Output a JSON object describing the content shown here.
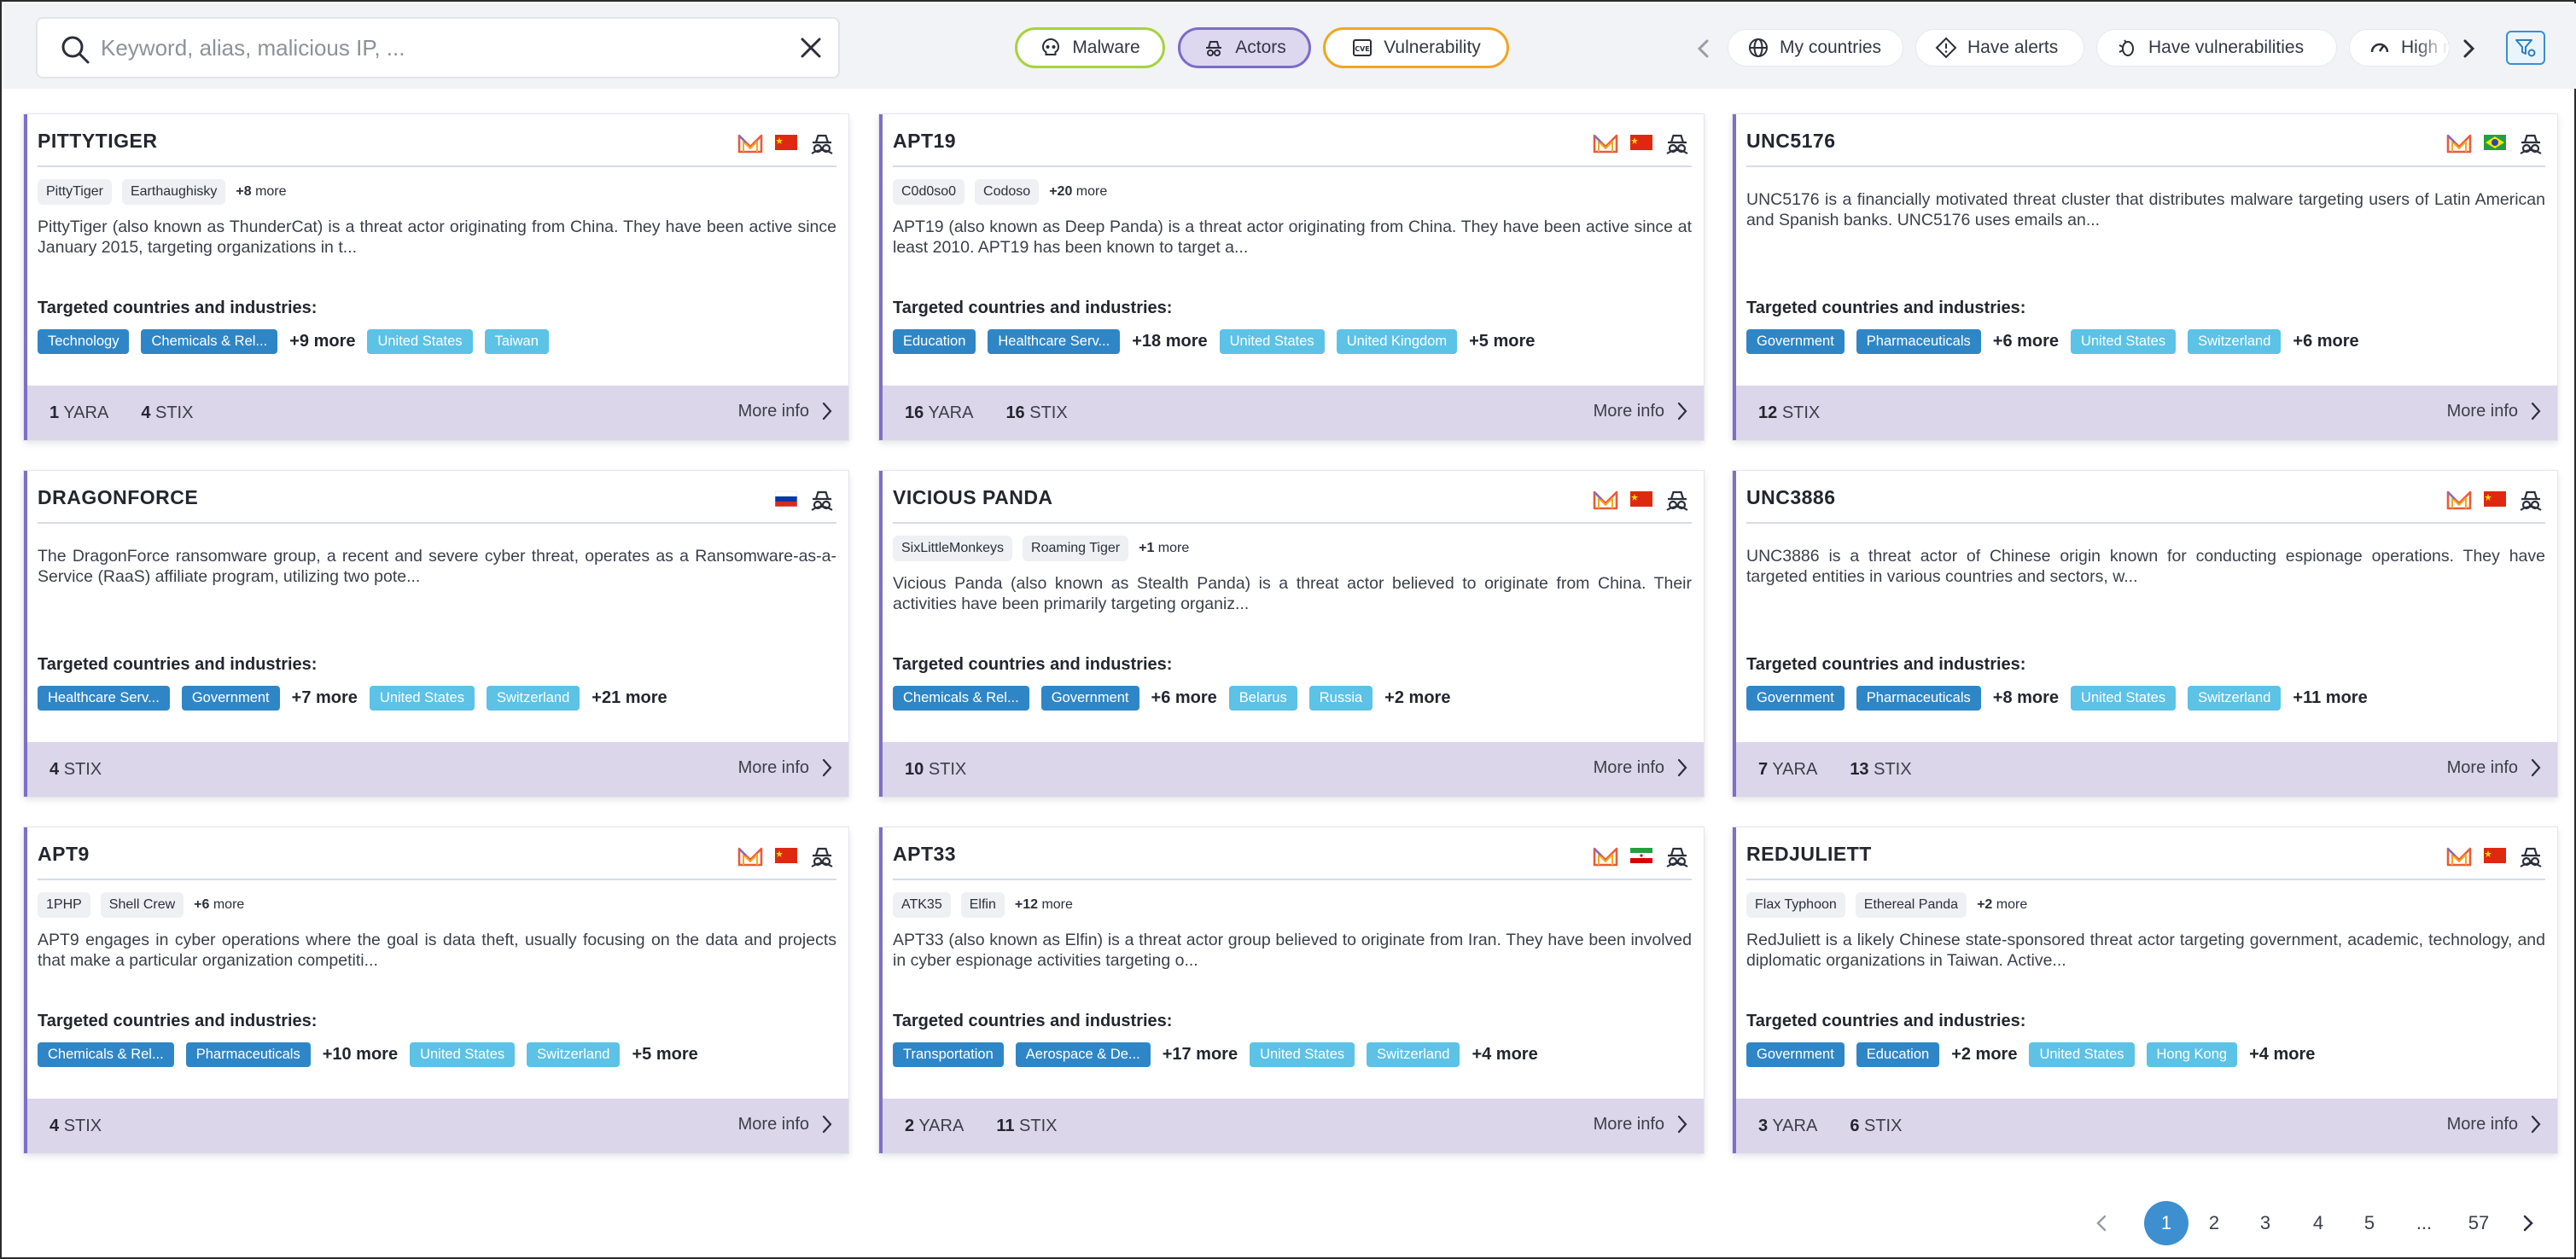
{
  "search": {
    "placeholder": "Keyword, alias, malicious IP, ..."
  },
  "type_filters": [
    {
      "label": "Malware",
      "color": "#a6d33d"
    },
    {
      "label": "Actors",
      "color": "#7d6bc9",
      "active": true
    },
    {
      "label": "Vulnerability",
      "color": "#f0a623"
    }
  ],
  "quick_filters": [
    {
      "label": "My countries",
      "icon": "globe-icon"
    },
    {
      "label": "Have alerts",
      "icon": "alert-diamond-icon"
    },
    {
      "label": "Have vulnerabilities",
      "icon": "bug-icon"
    },
    {
      "label": "High risk",
      "icon": "gauge-icon"
    }
  ],
  "labels": {
    "targeted": "Targeted countries and industries:",
    "more_info": "More info",
    "yara": "YARA",
    "stix": "STIX"
  },
  "cards": [
    {
      "title": "PITTYTIGER",
      "flag": "china",
      "malware_icon": true,
      "aliases": [
        "PittyTiger",
        "Earthaughisky"
      ],
      "aliases_more": "+8",
      "description": "PittyTiger (also known as ThunderCat) is a threat actor originating from China. They have been active since January 2015, targeting organizations in t...",
      "industries": [
        "Technology",
        "Chemicals & Rel..."
      ],
      "industries_more": "+9 more",
      "countries": [
        "United States",
        "Taiwan"
      ],
      "countries_more": "",
      "yara": "1",
      "stix": "4"
    },
    {
      "title": "APT19",
      "flag": "china",
      "malware_icon": true,
      "aliases": [
        "C0d0so0",
        "Codoso"
      ],
      "aliases_more": "+20",
      "description": "APT19 (also known as Deep Panda) is a threat actor originating from China. They have been active since at least 2010. APT19 has been known to target a...",
      "industries": [
        "Education",
        "Healthcare Serv..."
      ],
      "industries_more": "+18 more",
      "countries": [
        "United States",
        "United Kingdom"
      ],
      "countries_more": "+5 more",
      "yara": "16",
      "stix": "16"
    },
    {
      "title": "UNC5176",
      "flag": "brazil",
      "malware_icon": true,
      "aliases": [],
      "aliases_more": "",
      "description": "UNC5176 is a financially motivated threat cluster that distributes malware targeting users of Latin American and Spanish banks. UNC5176 uses emails an...",
      "industries": [
        "Government",
        "Pharmaceuticals"
      ],
      "industries_more": "+6 more",
      "countries": [
        "United States",
        "Switzerland"
      ],
      "countries_more": "+6 more",
      "yara": "",
      "stix": "12"
    },
    {
      "title": "DRAGONFORCE",
      "flag": "russia",
      "malware_icon": false,
      "aliases": [],
      "aliases_more": "",
      "description": "The DragonForce ransomware group, a recent and severe cyber threat, operates as a Ransomware-as-a-Service (RaaS) affiliate program, utilizing two pote...",
      "industries": [
        "Healthcare Serv...",
        "Government"
      ],
      "industries_more": "+7 more",
      "countries": [
        "United States",
        "Switzerland"
      ],
      "countries_more": "+21 more",
      "yara": "",
      "stix": "4"
    },
    {
      "title": "VICIOUS PANDA",
      "flag": "china",
      "malware_icon": true,
      "aliases": [
        "SixLittleMonkeys",
        "Roaming Tiger"
      ],
      "aliases_more": "+1",
      "description": "Vicious Panda (also known as Stealth Panda) is a threat actor believed to originate from China. Their activities have been primarily targeting organiz...",
      "industries": [
        "Chemicals & Rel...",
        "Government"
      ],
      "industries_more": "+6 more",
      "countries": [
        "Belarus",
        "Russia"
      ],
      "countries_more": "+2 more",
      "yara": "",
      "stix": "10"
    },
    {
      "title": "UNC3886",
      "flag": "china",
      "malware_icon": true,
      "aliases": [],
      "aliases_more": "",
      "description": "UNC3886 is a threat actor of Chinese origin known for conducting espionage operations. They have targeted entities in various countries and sectors, w...",
      "industries": [
        "Government",
        "Pharmaceuticals"
      ],
      "industries_more": "+8 more",
      "countries": [
        "United States",
        "Switzerland"
      ],
      "countries_more": "+11 more",
      "yara": "7",
      "stix": "13"
    },
    {
      "title": "APT9",
      "flag": "china",
      "malware_icon": true,
      "aliases": [
        "1PHP",
        "Shell Crew"
      ],
      "aliases_more": "+6",
      "description": "APT9 engages in cyber operations where the goal is data theft, usually focusing on the data and projects that make a particular organization competiti...",
      "industries": [
        "Chemicals & Rel...",
        "Pharmaceuticals"
      ],
      "industries_more": "+10 more",
      "countries": [
        "United States",
        "Switzerland"
      ],
      "countries_more": "+5 more",
      "yara": "",
      "stix": "4"
    },
    {
      "title": "APT33",
      "flag": "iran",
      "malware_icon": true,
      "aliases": [
        "ATK35",
        "Elfin"
      ],
      "aliases_more": "+12",
      "description": "APT33 (also known as Elfin) is a threat actor group believed to originate from Iran. They have been involved in cyber espionage activities targeting o...",
      "industries": [
        "Transportation",
        "Aerospace & De..."
      ],
      "industries_more": "+17 more",
      "countries": [
        "United States",
        "Switzerland"
      ],
      "countries_more": "+4 more",
      "yara": "2",
      "stix": "11"
    },
    {
      "title": "REDJULIETT",
      "flag": "china",
      "malware_icon": true,
      "aliases": [
        "Flax Typhoon",
        "Ethereal Panda"
      ],
      "aliases_more": "+2",
      "description": "RedJuliett is a likely Chinese state-sponsored threat actor targeting government, academic, technology, and diplomatic organizations in Taiwan. Active...",
      "industries": [
        "Government",
        "Education"
      ],
      "industries_more": "+2 more",
      "countries": [
        "United States",
        "Hong Kong"
      ],
      "countries_more": "+4 more",
      "yara": "3",
      "stix": "6"
    }
  ],
  "pagination": {
    "pages": [
      "1",
      "2",
      "3",
      "4",
      "5",
      "...",
      "57"
    ],
    "current": "1"
  },
  "colors": {
    "accent": "#7e6fc8",
    "industry_tag": "#2f86c6",
    "country_tag": "#5cc2e6",
    "card_footer": "#dbd6ea",
    "pager_active": "#3d8fd0"
  }
}
